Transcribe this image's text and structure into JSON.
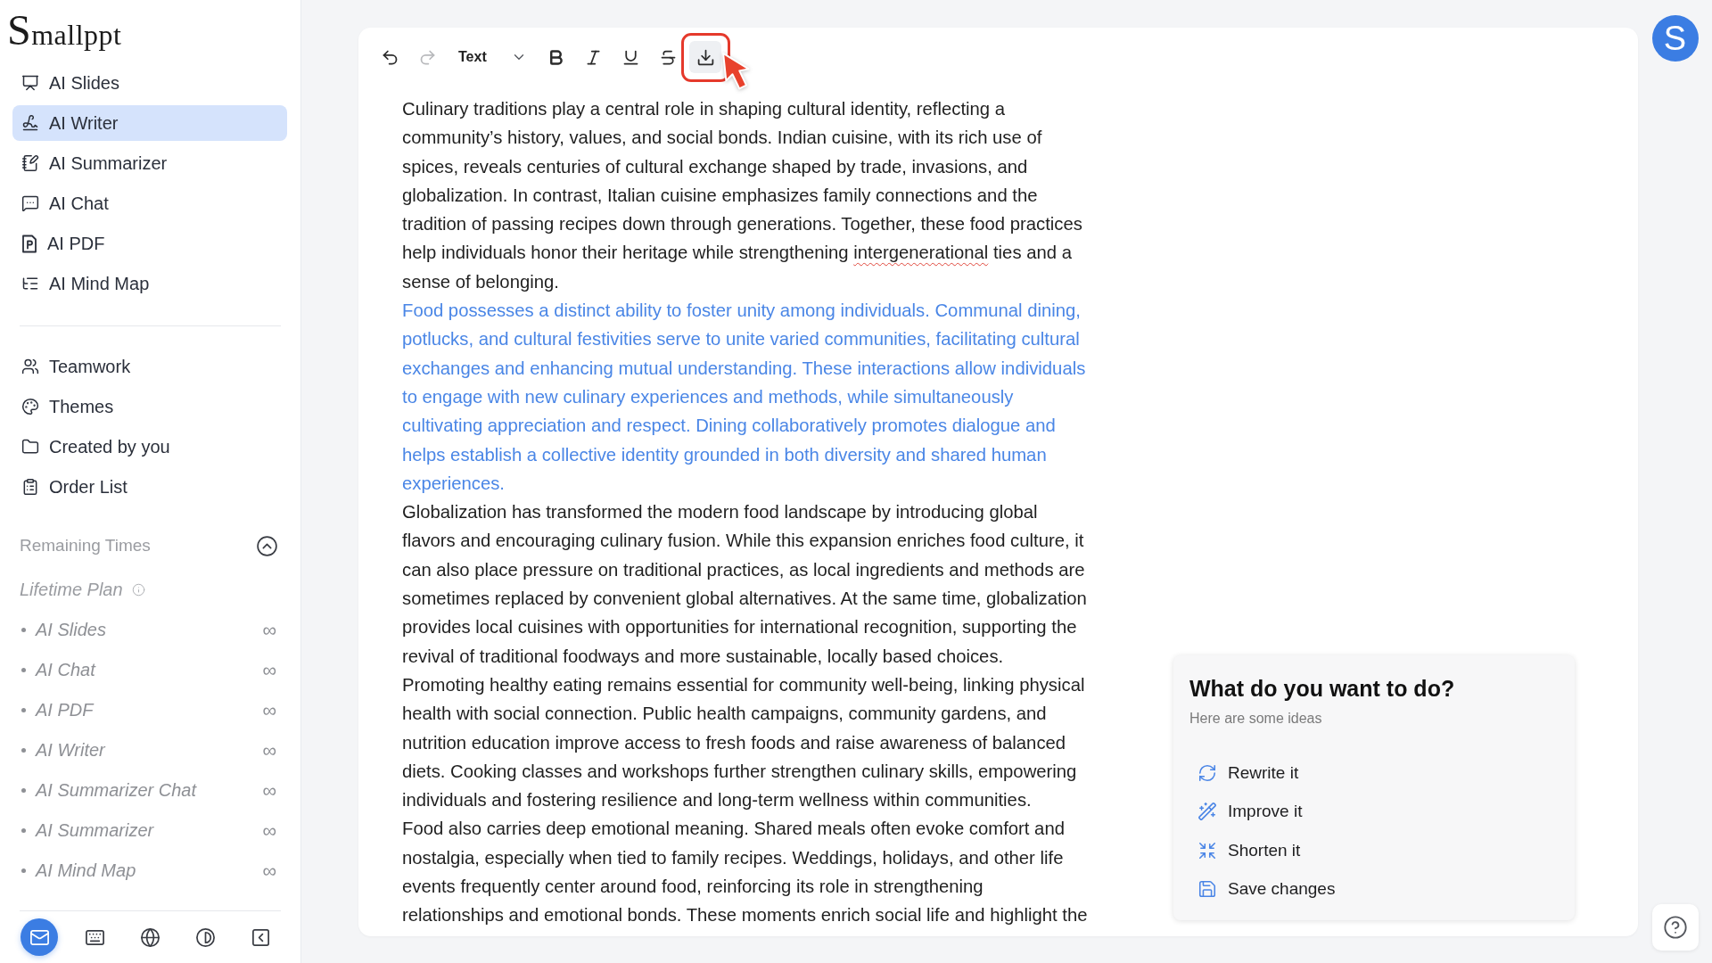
{
  "sidebar": {
    "logo": "Smallppt",
    "nav_primary": [
      {
        "label": "AI Slides",
        "selected": false
      },
      {
        "label": "AI Writer",
        "selected": true
      },
      {
        "label": "AI Summarizer",
        "selected": false
      },
      {
        "label": "AI Chat",
        "selected": false
      },
      {
        "label": "AI PDF",
        "selected": false
      },
      {
        "label": "AI Mind Map",
        "selected": false
      }
    ],
    "nav_secondary": [
      {
        "label": "Teamwork",
        "selected": false
      },
      {
        "label": "Themes",
        "selected": false
      },
      {
        "label": "Created by you",
        "selected": false
      },
      {
        "label": "Order List",
        "selected": false
      }
    ],
    "remaining": {
      "title": "Remaining Times",
      "expanded": true,
      "plan": "Lifetime Plan",
      "items": [
        {
          "label": "AI Slides",
          "value": "∞"
        },
        {
          "label": "AI Chat",
          "value": "∞"
        },
        {
          "label": "AI PDF",
          "value": "∞"
        },
        {
          "label": "AI Writer",
          "value": "∞"
        },
        {
          "label": "AI Summarizer Chat",
          "value": "∞"
        },
        {
          "label": "AI Summarizer",
          "value": "∞"
        },
        {
          "label": "AI Mind Map",
          "value": "∞"
        }
      ]
    },
    "footer_buttons": [
      {
        "primary": true
      },
      {
        "primary": false
      },
      {
        "primary": false
      },
      {
        "primary": false
      },
      {
        "primary": false
      }
    ]
  },
  "editor": {
    "toolbar": [
      {
        "kind": "undo",
        "disabled": false,
        "highlighted": false
      },
      {
        "kind": "redo",
        "disabled": true,
        "highlighted": false
      },
      {
        "kind": "dropdown",
        "value": "Text",
        "disabled": false,
        "highlighted": false
      },
      {
        "kind": "bold",
        "disabled": false,
        "highlighted": false
      },
      {
        "kind": "italic",
        "disabled": false,
        "highlighted": false
      },
      {
        "kind": "underline",
        "disabled": false,
        "highlighted": false
      },
      {
        "kind": "strikethrough",
        "disabled": false,
        "highlighted": false
      },
      {
        "kind": "download",
        "disabled": false,
        "highlighted": true
      }
    ],
    "paragraphs": [
      {
        "highlighted": false,
        "runs": [
          {
            "text": "Culinary traditions play a central role in shaping cultural identity, reflecting a community’s history, values, and social bonds. Indian cuisine, with its rich use of spices, reveals centuries of cultural exchange shaped by trade, invasions, and globalization. In contrast, Italian cuisine emphasizes family connections and the tradition of passing recipes down through generations. Together, these food practices help individuals honor their heritage while strengthening ",
            "misspelled": false
          },
          {
            "text": "intergenerational",
            "misspelled": true
          },
          {
            "text": " ties and a sense of belonging.",
            "misspelled": false
          }
        ]
      },
      {
        "highlighted": true,
        "runs": [
          {
            "text": "Food possesses a distinct ability to foster unity among individuals. Communal dining, potlucks, and cultural festivities serve to unite varied communities, facilitating cultural exchanges and enhancing mutual understanding. These interactions allow individuals to engage with new culinary experiences and methods, while simultaneously cultivating appreciation and respect. Dining collaboratively promotes dialogue and helps establish a collective identity grounded in both diversity and shared human experiences.",
            "misspelled": false
          }
        ]
      },
      {
        "highlighted": false,
        "runs": [
          {
            "text": "Globalization has transformed the modern food landscape by introducing global flavors and encouraging culinary fusion. While this expansion enriches food culture, it can also place pressure on traditional practices, as local ingredients and methods are sometimes replaced by convenient global alternatives. At the same time, globalization provides local cuisines with opportunities for international recognition, supporting the revival of traditional foodways and more sustainable, locally based choices.",
            "misspelled": false
          }
        ]
      },
      {
        "highlighted": false,
        "runs": [
          {
            "text": "Promoting healthy eating remains essential for community well-being, linking physical health with social connection. Public health campaigns, community gardens, and nutrition education improve access to fresh foods and raise awareness of balanced diets. Cooking classes and workshops further strengthen culinary skills, empowering individuals and fostering resilience and long-term wellness within communities.",
            "misspelled": false
          }
        ]
      },
      {
        "highlighted": false,
        "runs": [
          {
            "text": "Food also carries deep emotional meaning. Shared meals often evoke comfort and nostalgia, especially when tied to family recipes. Weddings, holidays, and other life events frequently center around food, reinforcing its role in strengthening relationships and emotional bonds. These moments enrich social life and highlight the",
            "misspelled": false
          }
        ]
      }
    ]
  },
  "suggestions": {
    "title": "What do you want to do?",
    "subtitle": "Here are some ideas",
    "actions": [
      "Rewrite it",
      "Improve it",
      "Shorten it",
      "Save changes"
    ]
  },
  "avatar": {
    "initial": "S"
  }
}
